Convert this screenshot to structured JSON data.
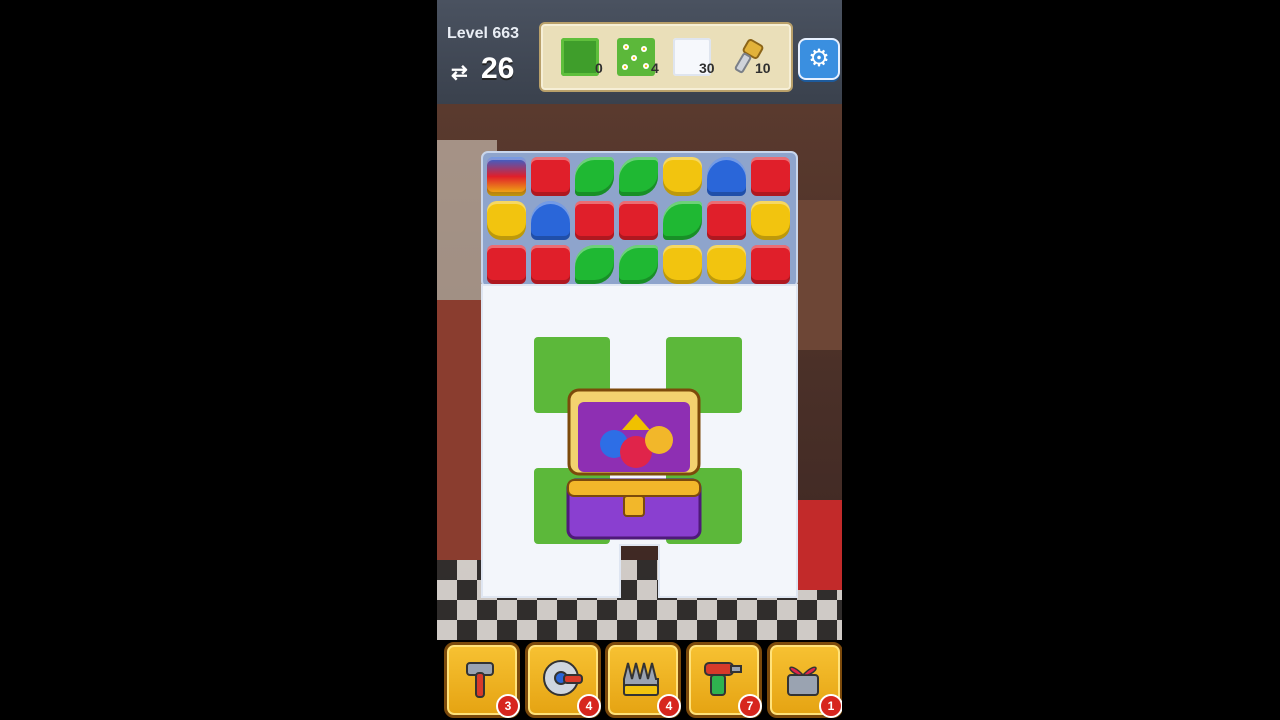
{
  "hud": {
    "level": "Level 663",
    "moves": "26",
    "goals": [
      {
        "icon": "grass-tile-icon",
        "count": "0"
      },
      {
        "icon": "flower-grass-tile-icon",
        "count": "4"
      },
      {
        "icon": "snow-tile-icon",
        "count": "30"
      },
      {
        "icon": "key-icon",
        "count": "10"
      }
    ]
  },
  "boosters": [
    {
      "name": "hammer",
      "icon": "hammer-icon",
      "count": "3"
    },
    {
      "name": "saw",
      "icon": "saw-icon",
      "count": "4"
    },
    {
      "name": "rake",
      "icon": "rake-icon",
      "count": "4"
    },
    {
      "name": "drill",
      "icon": "drill-icon",
      "count": "7"
    },
    {
      "name": "gift-box",
      "icon": "gift-box-icon",
      "count": "1"
    }
  ],
  "colors": {
    "hud": "#4a5260",
    "accent": "#3a8fe0",
    "booster": "#f2b72a",
    "red": "#e01f2a",
    "green": "#1fb833",
    "yellow": "#f2c40f",
    "blue": "#2a66d9"
  },
  "board": {
    "rows": [
      [
        "spinner",
        "red-can",
        "leaf",
        "leaf",
        "bucket",
        "cap",
        "red-can"
      ],
      [
        "bucket",
        "cap",
        "red-can",
        "red-can",
        "leaf",
        "red-can",
        "bucket"
      ],
      [
        "red-can",
        "red-can",
        "leaf",
        "leaf",
        "bucket",
        "bucket",
        "red-can"
      ]
    ]
  }
}
